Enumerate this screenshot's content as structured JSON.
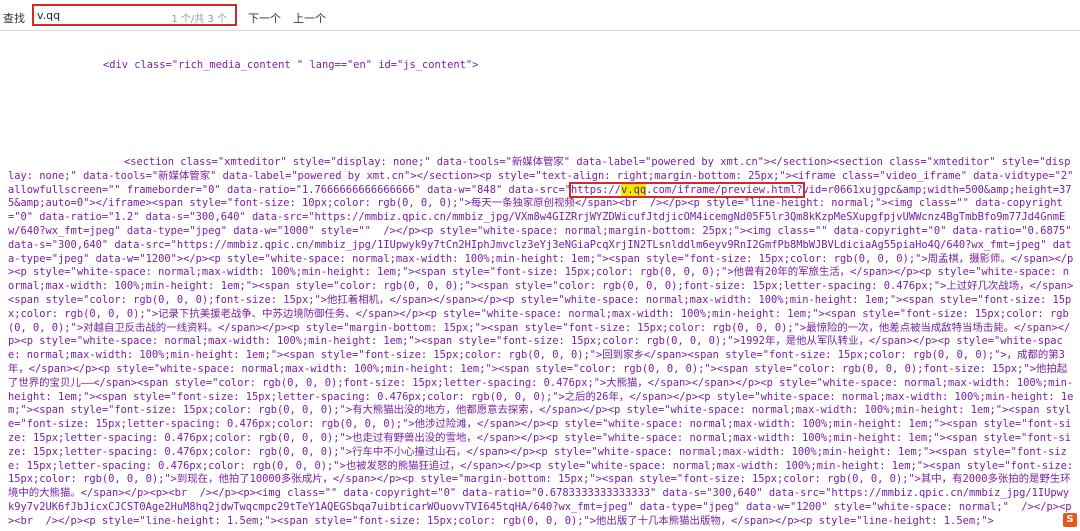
{
  "findbar": {
    "label": "查找",
    "query": "v.qq",
    "count": "1 个/共 3 个",
    "next": "下一个",
    "prev": "上一个"
  },
  "source": {
    "open_div": "<div class=\"rich_media_content \" lang==\"en\" id=\"js_content\">",
    "before": "<section class=\"xmteditor\" style=\"display: none;\" data-tools=\"新媒体管家\" data-label=\"powered by xmt.cn\"></section><section class=\"xmteditor\" style=\"display: none;\" data-tools=\"新媒体管家\" data-label=\"powered by xmt.cn\"></section><p style=\"text-align: right;margin-bottom: 25px;\"><iframe class=\"video_iframe\" data-vidtype=\"2\" allowfullscreen=\"\" frameborder=\"0\" data-ratio=\"1.7666666666666666\" data-w=\"848\" data-src=\"",
    "url_pre": "https://",
    "url_match": "v.qq",
    "url_post": ".com/iframe/preview.html?",
    "after": "vid=r0661xujgpc&amp;width=500&amp;height=375&amp;auto=0\"></iframe><span style=\"font-size: 10px;color: rgb(0, 0, 0);\">每天一条独家原创视频</span><br  /></p><p style=\"line-height: normal;\"><img class=\"\" data-copyright=\"0\" data-ratio=\"1.2\" data-s=\"300,640\" data-src=\"https://mmbiz.qpic.cn/mmbiz_jpg/VXm8w4GIZRrjWYZDWicufJtdjicOM4icemgNd05F5lr3Qm8kKzpMeSXupgfpjvUWWcnz4BgTmbBfo9m77Jd4GnmEw/640?wx_fmt=jpeg\" data-type=\"jpeg\" data-w=\"1000\" style=\"\"  /></p><p style=\"white-space: normal;margin-bottom: 25px;\"><img class=\"\" data-copyright=\"0\" data-ratio=\"0.6875\" data-s=\"300,640\" data-src=\"https://mmbiz.qpic.cn/mmbiz_jpg/1IUpwyk9y7tCn2HIphJmvclz3eYj3eNGiaPcqXrjIN2TLsnlddlm6eyv9RnI2GmfPb8MbWJBVLdiciaAg55piaHo4Q/640?wx_fmt=jpeg\" data-type=\"jpeg\" data-w=\"1200\"></p><p style=\"white-space: normal;max-width: 100%;min-height: 1em;\"><span style=\"font-size: 15px;color: rgb(0, 0, 0);\">周孟棋，摄影师。</span></p><p style=\"white-space: normal;max-width: 100%;min-height: 1em;\"><span style=\"font-size: 15px;color: rgb(0, 0, 0);\">他曾有20年的军旅生活，</span></p><p style=\"white-space: normal;max-width: 100%;min-height: 1em;\"><span style=\"color: rgb(0, 0, 0);\"><span style=\"color: rgb(0, 0, 0);font-size: 15px;letter-spacing: 0.476px;\">上过好几次战场，</span><span style=\"color: rgb(0, 0, 0);font-size: 15px;\">他扛着相机，</span></span></p><p style=\"white-space: normal;max-width: 100%;min-height: 1em;\"><span style=\"font-size: 15px;color: rgb(0, 0, 0);\">记录下抗美援老战争、中苏边境防御任务、</span></p><p style=\"white-space: normal;max-width: 100%;min-height: 1em;\"><span style=\"font-size: 15px;color: rgb(0, 0, 0);\">对越自卫反击战的一线资料。</span></p><p style=\"margin-bottom: 15px;\"><span style=\"font-size: 15px;color: rgb(0, 0, 0);\">最惊险的一次，他差点被当成敌特当场击毙。</span></p><p style=\"white-space: normal;max-width: 100%;min-height: 1em;\"><span style=\"font-size: 15px;color: rgb(0, 0, 0);\">1992年，是他从军队转业，</span></p><p style=\"white-space: normal;max-width: 100%;min-height: 1em;\"><span style=\"font-size: 15px;color: rgb(0, 0, 0);\">回到家乡</span><span style=\"font-size: 15px;color: rgb(0, 0, 0);\">，成都的第3年，</span></p><p style=\"white-space: normal;max-width: 100%;min-height: 1em;\"><span style=\"color: rgb(0, 0, 0);\"><span style=\"color: rgb(0, 0, 0);font-size: 15px;\">他拍起了世界的宝贝儿——</span><span style=\"color: rgb(0, 0, 0);font-size: 15px;letter-spacing: 0.476px;\">大熊猫，</span></span></p><p style=\"white-space: normal;max-width: 100%;min-height: 1em;\"><span style=\"font-size: 15px;letter-spacing: 0.476px;color: rgb(0, 0, 0);\">之后的26年，</span></p><p style=\"white-space: normal;max-width: 100%;min-height: 1em;\"><span style=\"font-size: 15px;color: rgb(0, 0, 0);\">有大熊猫出没的地方，他都愿意去探索，</span></p><p style=\"white-space: normal;max-width: 100%;min-height: 1em;\"><span style=\"font-size: 15px;letter-spacing: 0.476px;color: rgb(0, 0, 0);\">他涉过险滩，</span></p><p style=\"white-space: normal;max-width: 100%;min-height: 1em;\"><span style=\"font-size: 15px;letter-spacing: 0.476px;color: rgb(0, 0, 0);\">也走过有野兽出没的雪地，</span></p><p style=\"white-space: normal;max-width: 100%;min-height: 1em;\"><span style=\"font-size: 15px;letter-spacing: 0.476px;color: rgb(0, 0, 0);\">行车中不小心撞过山石，</span></p><p style=\"white-space: normal;max-width: 100%;min-height: 1em;\"><span style=\"font-size: 15px;letter-spacing: 0.476px;color: rgb(0, 0, 0);\">也被发怒的熊猫狂追过，</span></p><p style=\"white-space: normal;max-width: 100%;min-height: 1em;\"><span style=\"font-size: 15px;color: rgb(0, 0, 0);\">到现在，他拍了10000多张成片，</span></p><p style=\"margin-bottom: 15px;\"><span style=\"font-size: 15px;color: rgb(0, 0, 0);\">其中，有2000多张拍的是野生环境中的大熊猫。</span></p><p><br  /></p><p><img class=\"\" data-copyright=\"0\" data-ratio=\"0.6783333333333333\" data-s=\"300,640\" data-src=\"https://mmbiz.qpic.cn/mmbiz_jpg/1IUpwyk9y7v2UK6fJbJicxCJCST0Age2HuM8hq2jdwTwqcmpc29tTeY1AQEGSbqa7uibticarWOuovvTVI645tqHA/640?wx_fmt=jpeg\" data-type=\"jpeg\" data-w=\"1200\" style=\"white-space: normal;\"  /></p><p><br  /></p><p style=\"line-height: 1.5em;\"><span style=\"font-size: 15px;color: rgb(0, 0, 0);\">他出版了十几本熊猫出版物，</span></p><p style=\"line-height: 1.5em;\">"
  },
  "icons": {
    "ime_badge": "S"
  },
  "colors": {
    "source_text": "#7a1fa2",
    "highlight_border": "#d12a2a",
    "match_highlight": "#f1e800"
  }
}
